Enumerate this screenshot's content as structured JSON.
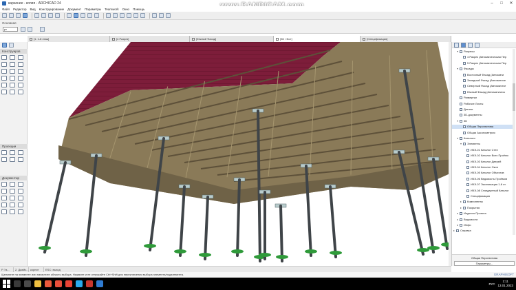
{
  "window": {
    "title": "карасние - копия - ARCHICAD 24",
    "watermark": "www.BANDICAM.com"
  },
  "menu": [
    "Файл",
    "Редактор",
    "Вид",
    "Конструирование",
    "Документ",
    "Параметры",
    "Teamwork",
    "Окно",
    "Помощь"
  ],
  "infobox": {
    "label": "Основная",
    "selector": "рт"
  },
  "tabs": [
    {
      "label": "[1. 1-й этаж]"
    },
    {
      "label": "[4 Разрез]"
    },
    {
      "label": "[Южный Фасад]"
    },
    {
      "label": "[3D / Все]"
    },
    {
      "label": "[Спецификация]"
    }
  ],
  "toolbox": {
    "sections": [
      "Конструиров",
      "Проекции",
      "Документир"
    ]
  },
  "navigator": {
    "items": [
      {
        "label": "Разрезы",
        "indent": 1,
        "arrow": "v"
      },
      {
        "label": "4 Разрез (Автоматическая Пер",
        "indent": 2
      },
      {
        "label": "5 Разрез (Автоматическая Пер",
        "indent": 2
      },
      {
        "label": "Фасады",
        "indent": 1,
        "arrow": "v"
      },
      {
        "label": "Восточный Фасад (Автомати",
        "indent": 2
      },
      {
        "label": "Западный Фасад (Автоматиче",
        "indent": 2
      },
      {
        "label": "Северный Фасад (Автоматиче",
        "indent": 2
      },
      {
        "label": "Южный Фасад (Автоматическ",
        "indent": 2
      },
      {
        "label": "Развертки",
        "indent": 1
      },
      {
        "label": "Рабочие Листы",
        "indent": 1
      },
      {
        "label": "Детали",
        "indent": 1
      },
      {
        "label": "3D-документы",
        "indent": 1
      },
      {
        "label": "3D",
        "indent": 1,
        "arrow": "v"
      },
      {
        "label": "Общая Перспектива",
        "indent": 2,
        "selected": true
      },
      {
        "label": "Общая Аксонометрия",
        "indent": 2
      },
      {
        "label": "Каталоги",
        "indent": 1,
        "arrow": "v"
      },
      {
        "label": "Элементы",
        "indent": 2,
        "arrow": "v"
      },
      {
        "label": "ИКЭ-01 Каталог Стен",
        "indent": 3
      },
      {
        "label": "ИКЭ-02 Каталог Всех Проёмо",
        "indent": 3
      },
      {
        "label": "ИКЭ-03 Каталог Дверей",
        "indent": 3
      },
      {
        "label": "ИКЭ-04 Каталог Окон",
        "indent": 3
      },
      {
        "label": "ИКЭ-05 Каталог Объектов",
        "indent": 3
      },
      {
        "label": "ИКЭ-06 Ведомость Проёмов",
        "indent": 3
      },
      {
        "label": "ИКЭ-07 Экспликация 1-й эт.",
        "indent": 3
      },
      {
        "label": "ИКЭ-08 Стандартный Каталог",
        "indent": 3
      },
      {
        "label": "Спецификация",
        "indent": 3
      },
      {
        "label": "Компоненты",
        "indent": 2,
        "arrow": ">"
      },
      {
        "label": "Покрытия",
        "indent": 2,
        "arrow": ">"
      },
      {
        "label": "Индексы Проекта",
        "indent": 1,
        "arrow": ">"
      },
      {
        "label": "Ведомости",
        "indent": 1,
        "arrow": ">"
      },
      {
        "label": "Инфо",
        "indent": 1,
        "arrow": ">"
      },
      {
        "label": "Справка",
        "indent": 0,
        "arrow": ">"
      }
    ],
    "panel_title": "Свойства",
    "current_view": "Общая Перспектива",
    "params_button": "Параметры..."
  },
  "status": {
    "zoom": "Р. Уз...",
    "view": "2. Джейс...",
    "layer": "корпит",
    "cutplane": "ESC: выход"
  },
  "hint": "Щелкните на элементе или начертите область выбора. Нажмите и не отпускайте Ctrl+Shift для переключения выбора элемента/подэлемента.",
  "brand": "GRAPHISOFT",
  "tray": {
    "lang": "РУС",
    "time": "1:11",
    "date": "13.01.2023"
  },
  "colors": {
    "roof": "#7d1d3a",
    "wood": "#8a7a58",
    "pile": "#3f4448",
    "plate": "#b9cccc",
    "grass": "#2f9a3a"
  }
}
